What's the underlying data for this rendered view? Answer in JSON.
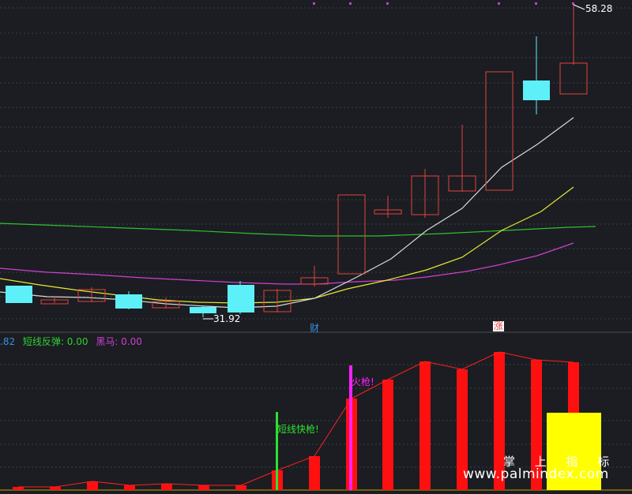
{
  "header": {
    "dots_color": "#c040c0"
  },
  "price_panel": {
    "high_label": "58.28",
    "low_label": "31.92",
    "marker_cai": "财",
    "marker_zhang": "涨",
    "colors": {
      "up": "#e0443c",
      "down": "#5ef0f8",
      "ma_white": "#d8d8d8",
      "ma_yellow": "#e8e830",
      "ma_magenta": "#d040d0",
      "ma_green": "#30c030"
    }
  },
  "indicator_panel": {
    "legend": [
      {
        "text": ".82",
        "color": "#3a8fe0"
      },
      {
        "text": "短线反弹: 0.00",
        "color": "#30d030"
      },
      {
        "text": "黑马: 0.00",
        "color": "#d040d0"
      }
    ],
    "signal_green": "短线快枪!",
    "signal_magenta": "火枪!"
  },
  "watermark": {
    "brand": "掌 上 指 标",
    "url": "www.palmindex.com"
  }
}
